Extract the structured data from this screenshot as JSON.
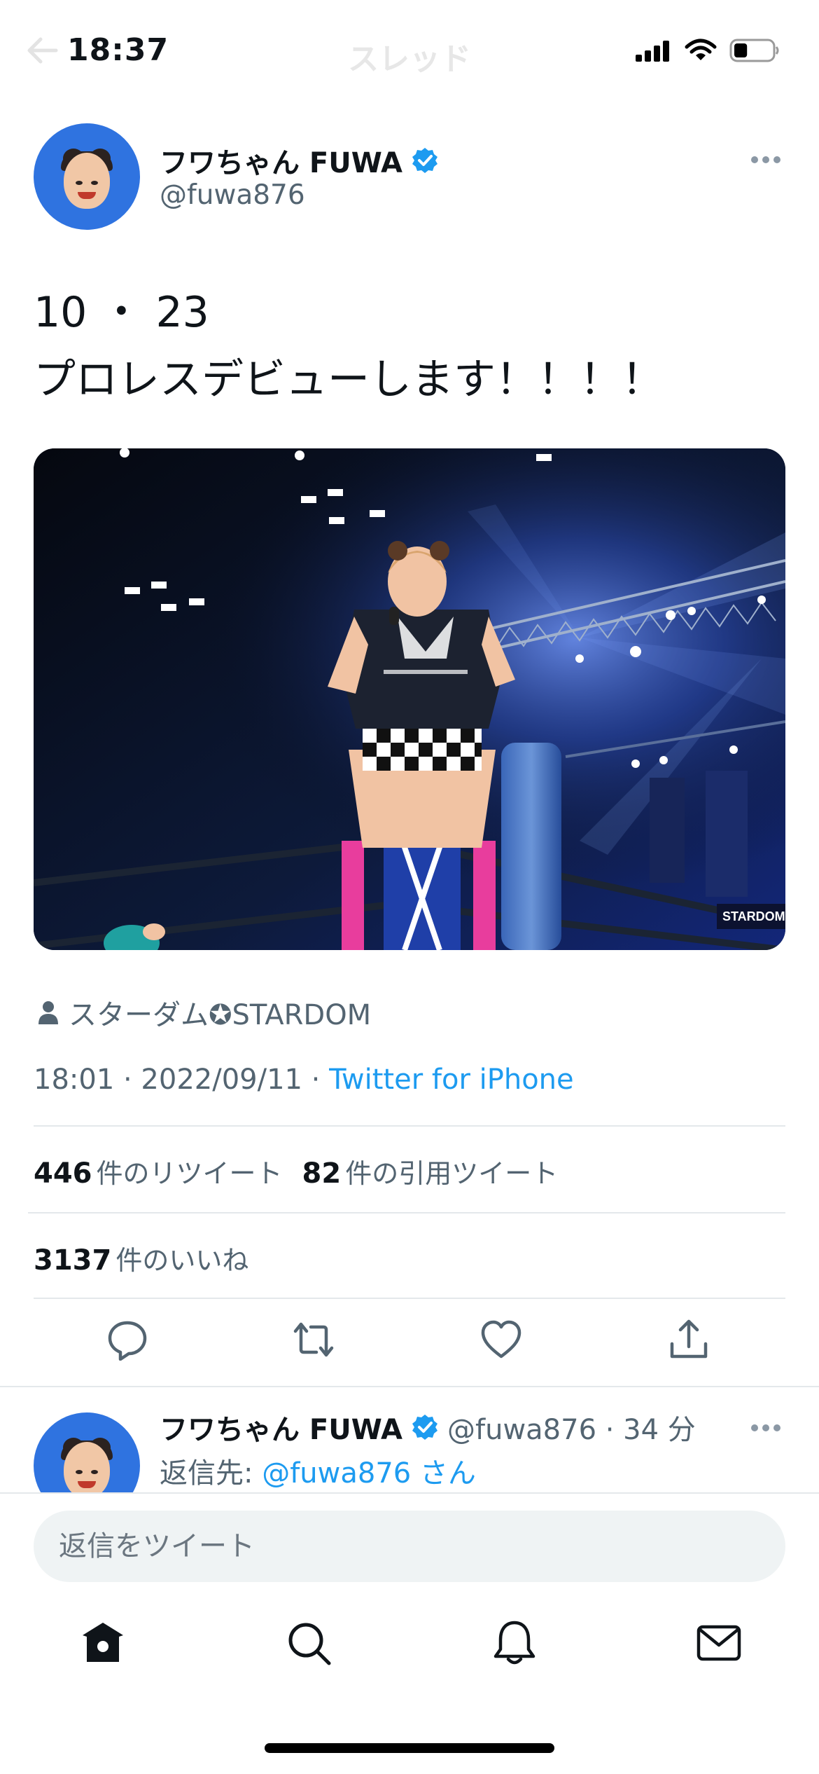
{
  "status_bar": {
    "time": "18:37",
    "nav_title": "スレッド",
    "battery_level": 0.35
  },
  "tweet": {
    "author": {
      "display_name": "フワちゃん FUWA",
      "handle": "@fuwa876",
      "verified": true
    },
    "text": "10 ・ 23\nプロレスデビューします！！！！",
    "tagged_user": "スターダム✪STARDOM",
    "meta": {
      "timestamp": "18:01 · 2022/09/11 · ",
      "source": "Twitter for iPhone"
    },
    "stats": {
      "retweets_count": "446",
      "retweets_label": "件のリツイート",
      "quotes_count": "82",
      "quotes_label": "件の引用ツイート",
      "likes_count": "3137",
      "likes_label": "件のいいね"
    },
    "actions": [
      "reply-icon",
      "retweet-icon",
      "like-icon",
      "share-icon"
    ]
  },
  "reply_preview": {
    "display_name": "フワちゃん FUWA",
    "handle_time": "@fuwa876 · 34 分",
    "reply_to_label": "返信先: ",
    "reply_to_handle": "@fuwa876 さん"
  },
  "composer": {
    "placeholder": "返信をツイート"
  },
  "tab_bar": [
    "home-icon",
    "search-icon",
    "notifications-icon",
    "messages-icon"
  ],
  "colors": {
    "accent": "#1d9bf0",
    "text_primary": "#0f1419",
    "text_secondary": "#536471",
    "avatar_bg": "#2f73e0"
  }
}
